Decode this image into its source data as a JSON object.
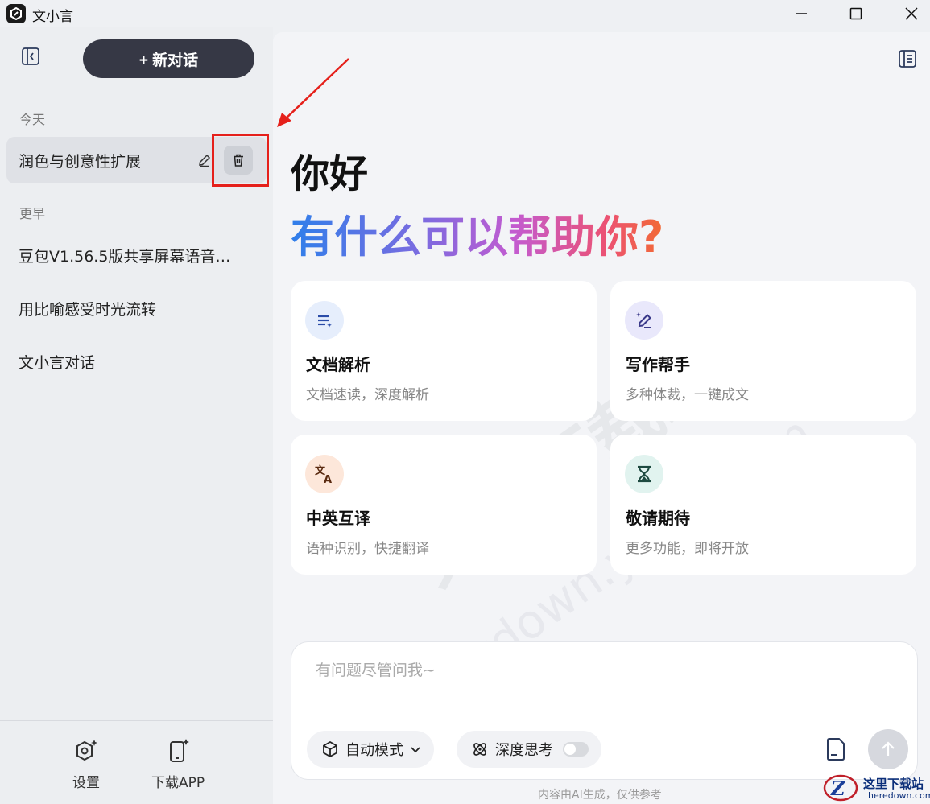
{
  "window": {
    "title": "文小言",
    "controls": [
      "minimize-icon",
      "maximize-icon",
      "close-icon"
    ]
  },
  "sidebar": {
    "new_chat_label": "+ 新对话",
    "sections": [
      {
        "label": "今天",
        "items": [
          "润色与创意性扩展"
        ]
      },
      {
        "label": "更早",
        "items": [
          "豆包V1.56.5版共享屏幕语音…",
          "用比喻感受时光流转",
          "文小言对话"
        ]
      }
    ],
    "footer": [
      {
        "label": "设置",
        "icon": "settings-sparkle-icon"
      },
      {
        "label": "下载APP",
        "icon": "phone-sparkle-icon"
      }
    ]
  },
  "main": {
    "greeting": "你好",
    "subtitle": "有什么可以帮助你?",
    "cards": [
      {
        "title": "文档解析",
        "desc": "文档速读，深度解析",
        "icon": "document-list-icon",
        "icon_bg": "#e6eefc",
        "icon_color": "#2b4ca8"
      },
      {
        "title": "写作帮手",
        "desc": "多种体裁，一键成文",
        "icon": "pen-sparkle-icon",
        "icon_bg": "#e9e8fb",
        "icon_color": "#3b3a8a"
      },
      {
        "title": "中英互译",
        "desc": "语种识别，快捷翻译",
        "icon": "translate-icon",
        "icon_bg": "#fde7da",
        "icon_color": "#5a2a10"
      },
      {
        "title": "敬请期待",
        "desc": "更多功能，即将开放",
        "icon": "hourglass-icon",
        "icon_bg": "#e1f3ef",
        "icon_color": "#1d4a40"
      }
    ],
    "input": {
      "placeholder": "有问题尽管问我~",
      "mode_label": "自动模式",
      "deep_think_label": "深度思考",
      "deep_think_on": false
    },
    "disclaimer": "内容由AI生成，仅供参考"
  },
  "overlay": {
    "watermark": "天极下载站",
    "watermark_url": "mydown.yesky.com",
    "site_logo_name": "这里下载站",
    "site_logo_url": "heredown.com"
  }
}
